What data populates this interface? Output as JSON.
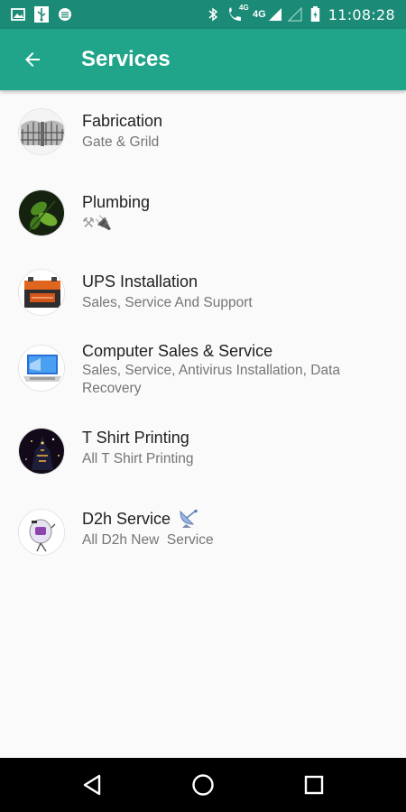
{
  "status_bar": {
    "time": "11:08:28",
    "network_label": "4G",
    "volte_label": "4G",
    "icons": [
      "image-icon",
      "usb-icon",
      "record-icon",
      "bluetooth-icon",
      "wifi-calling-icon",
      "signal-icon",
      "battery-icon"
    ]
  },
  "app_bar": {
    "title": "Services",
    "back_icon": "arrow-back-icon"
  },
  "services": [
    {
      "title": "Fabrication",
      "subtitle": "Gate & Grild",
      "icon": "fabrication-gate-image"
    },
    {
      "title": "Plumbing",
      "subtitle": "⚒🔌",
      "icon": "plumbing-leaf-image"
    },
    {
      "title": "UPS Installation",
      "subtitle": "Sales, Service And Support",
      "icon": "ups-battery-image"
    },
    {
      "title": "Computer Sales & Service",
      "subtitle": "Sales, Service, Antivirus Installation, Data Recovery",
      "icon": "computer-laptop-image"
    },
    {
      "title": "T Shirt Printing",
      "subtitle": "All T Shirt Printing",
      "icon": "tshirt-print-image"
    },
    {
      "title": "D2h Service",
      "subtitle": "All D2h New  Service",
      "icon": "d2h-dish-image",
      "badge": "satellite-antenna-icon"
    }
  ],
  "nav_bar": {
    "icons": [
      "back-triangle-icon",
      "home-circle-icon",
      "recents-square-icon"
    ]
  },
  "colors": {
    "status_bar": "#1b8a76",
    "app_bar": "#20a58a",
    "background": "#fafafa",
    "title_text": "#212121",
    "subtitle_text": "#757575"
  }
}
